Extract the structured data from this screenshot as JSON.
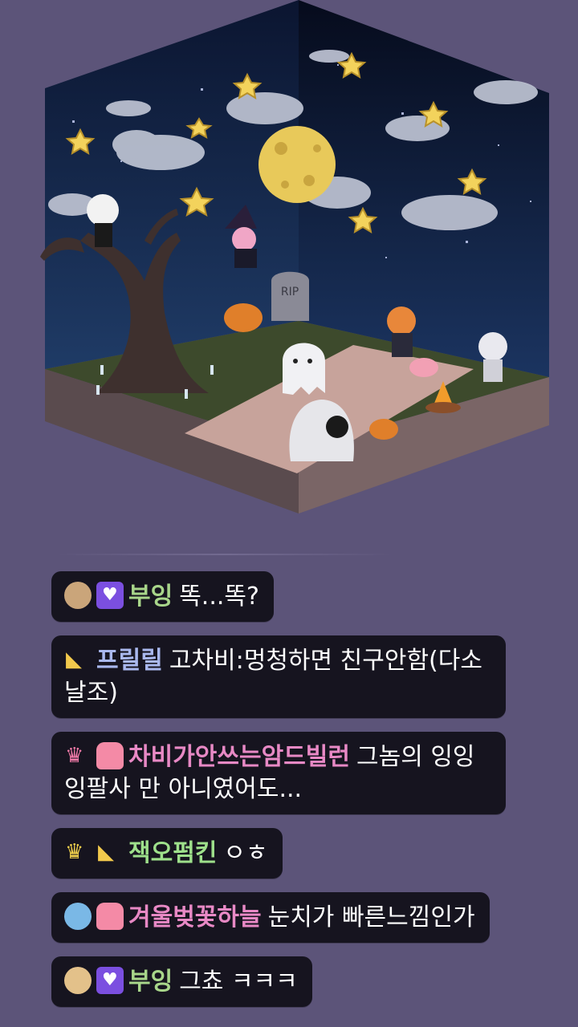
{
  "colors": {
    "page_bg": "#5c5479",
    "bubble_bg": "#16141f",
    "nick_green": "#a8d68a",
    "nick_blue": "#a9b8ee",
    "nick_pink": "#e889c5",
    "nick_green2": "#9ee08b"
  },
  "scene": {
    "tombstone_text": "RIP"
  },
  "messages": [
    {
      "badges": [
        "cat-face-icon",
        "purple-heart-icon"
      ],
      "nick": "부잉",
      "nick_color": "#a8d68a",
      "text": "똑...똑?"
    },
    {
      "badges": [
        "cheese-icon"
      ],
      "nick": "프릴릴",
      "nick_color": "#a9b8ee",
      "text": "고차비:멍청하면 친구안함(다소날조)"
    },
    {
      "badges": [
        "crown-sparkle-icon",
        "pink-cat-icon"
      ],
      "nick": "차비가안쓰는암드빌런",
      "nick_color": "#e889c5",
      "text": "그놈의 잉잉잉팔사 만 아니였어도..."
    },
    {
      "badges": [
        "crown-icon",
        "cheese-icon"
      ],
      "nick": "잭오펌킨",
      "nick_color": "#9ee08b",
      "text": "ㅇㅎ"
    },
    {
      "badges": [
        "blue-creature-icon",
        "pink-cat-icon"
      ],
      "nick": "겨울벚꽃하늘",
      "nick_color": "#e889c5",
      "text": "눈치가 빠른느낌인가"
    },
    {
      "badges": [
        "cat-face-icon",
        "purple-heart-icon"
      ],
      "nick": "부잉",
      "nick_color": "#a8d68a",
      "text": "그쵸 ㅋㅋㅋ"
    }
  ]
}
